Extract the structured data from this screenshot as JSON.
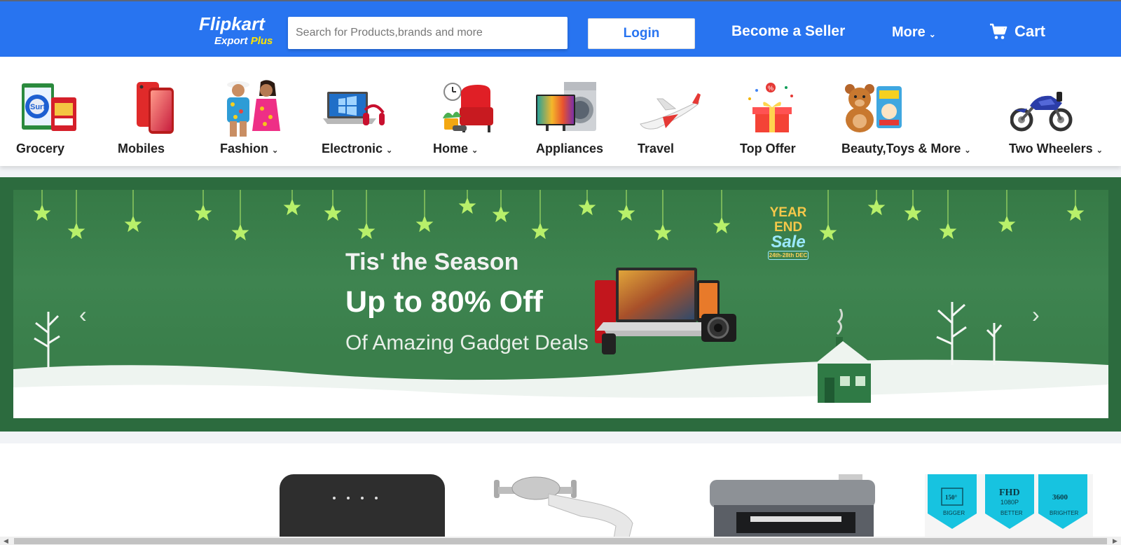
{
  "header": {
    "logo_main": "Flipkart",
    "logo_sub": "Export",
    "logo_plus": "Plus",
    "search_placeholder": "Search for Products,brands and more",
    "login_label": "Login",
    "seller_label": "Become a Seller",
    "more_label": "More",
    "cart_label": "Cart",
    "brand_color": "#2874f0",
    "accent_color": "#ffe500"
  },
  "categories": [
    {
      "label": "Grocery",
      "icon": "grocery-icon",
      "has_dropdown": false
    },
    {
      "label": "Mobiles",
      "icon": "mobiles-icon",
      "has_dropdown": false
    },
    {
      "label": "Fashion",
      "icon": "fashion-icon",
      "has_dropdown": true
    },
    {
      "label": "Electronic",
      "icon": "electronics-icon",
      "has_dropdown": true
    },
    {
      "label": "Home",
      "icon": "home-furniture-icon",
      "has_dropdown": true
    },
    {
      "label": "Appliances",
      "icon": "appliances-icon",
      "has_dropdown": false
    },
    {
      "label": "Travel",
      "icon": "airplane-icon",
      "has_dropdown": false
    },
    {
      "label": "Top Offer",
      "icon": "gift-icon",
      "has_dropdown": false
    },
    {
      "label": "Beauty,Toys & More",
      "icon": "toys-icon",
      "has_dropdown": true
    },
    {
      "label": "Two Wheelers",
      "icon": "motorbike-icon",
      "has_dropdown": true
    }
  ],
  "banner": {
    "line1": "Tis' the Season",
    "line2": "Up to 80% Off",
    "line3": "Of Amazing Gadget Deals",
    "badge_line1": "YEAR",
    "badge_line2": "END",
    "badge_line3": "Sale",
    "badge_dates": "24th-28th DEC"
  },
  "products": {
    "badges": [
      {
        "top": "150°",
        "bottom": "BIGGER"
      },
      {
        "top": "FHD",
        "mid": "1080P",
        "bottom": "BETTER"
      },
      {
        "top": "3600",
        "bottom": "BRIGHTER"
      }
    ]
  }
}
